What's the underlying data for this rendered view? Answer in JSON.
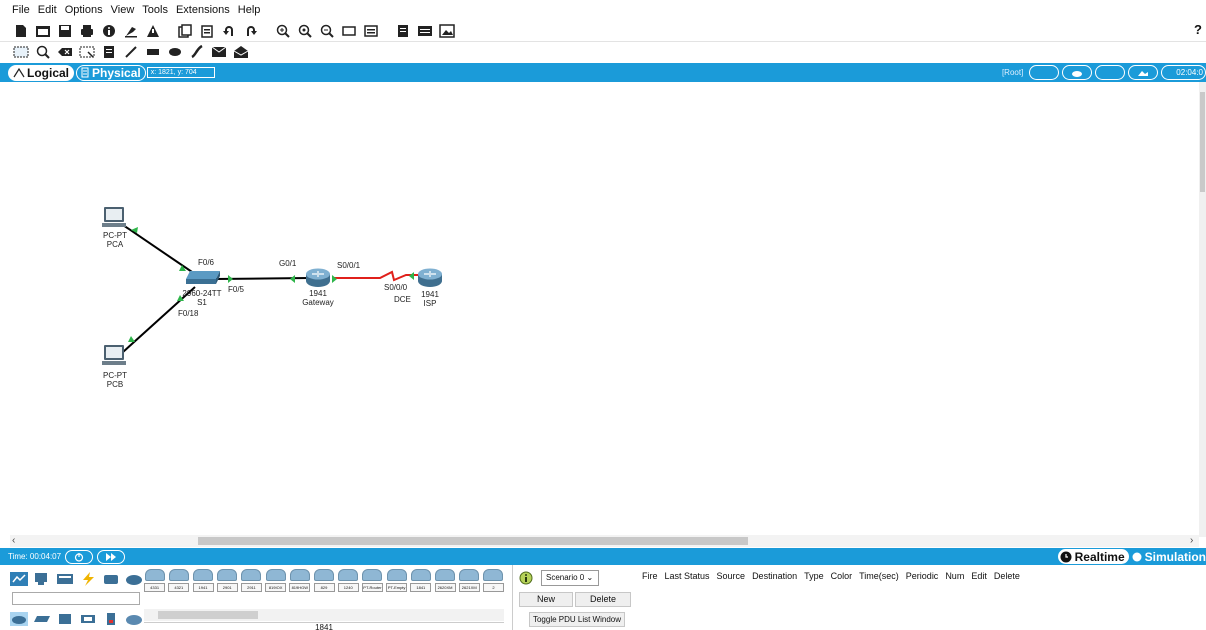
{
  "menubar": {
    "items": [
      "File",
      "Edit",
      "Options",
      "View",
      "Tools",
      "Extensions",
      "Help"
    ],
    "help": "?"
  },
  "workspace": {
    "tab_logical": "Logical",
    "tab_physical": "Physical",
    "coords": "x: 1821, y: 704",
    "root_label": "[Root]",
    "clock": "02:04:0"
  },
  "topology": {
    "devices": [
      {
        "id": "pca",
        "type": "PC",
        "model": "PC-PT",
        "name": "PCA"
      },
      {
        "id": "pcb",
        "type": "PC",
        "model": "PC-PT",
        "name": "PCB"
      },
      {
        "id": "s1",
        "type": "switch",
        "model": "2960-24TT",
        "name": "S1"
      },
      {
        "id": "gateway",
        "type": "router",
        "model": "1941",
        "name": "Gateway"
      },
      {
        "id": "isp",
        "type": "router",
        "model": "1941",
        "name": "ISP"
      }
    ],
    "ports": {
      "s1_f06": "F0/6",
      "s1_f05": "F0/5",
      "s1_f018": "F0/18",
      "gw_g01": "G0/1",
      "gw_s001": "S0/0/1",
      "isp_s000": "S0/0/0",
      "dce": "DCE"
    },
    "link_colors": {
      "ethernet": "#000000",
      "serial": "#e0201b",
      "link_up": "#2fb54a"
    }
  },
  "simulation": {
    "time": "Time: 00:04:07",
    "realtime": "Realtime",
    "simulation": "Simulation"
  },
  "device_palette": {
    "models": [
      "4331",
      "4321",
      "1941",
      "2901",
      "2911",
      "819IOX",
      "819HGW",
      "829",
      "1240",
      "PT-Router",
      "PT-Empty",
      "1841",
      "2620XM",
      "2621XM",
      "2"
    ],
    "selected_model": "1841"
  },
  "scenario": {
    "selected": "Scenario 0",
    "new_label": "New",
    "delete_label": "Delete",
    "toggle_label": "Toggle PDU List Window"
  },
  "pdu_list": {
    "columns": [
      "Fire",
      "Last Status",
      "Source",
      "Destination",
      "Type",
      "Color",
      "Time(sec)",
      "Periodic",
      "Num",
      "Edit",
      "Delete"
    ]
  },
  "colors": {
    "accent_blue": "#1b9bd9"
  }
}
